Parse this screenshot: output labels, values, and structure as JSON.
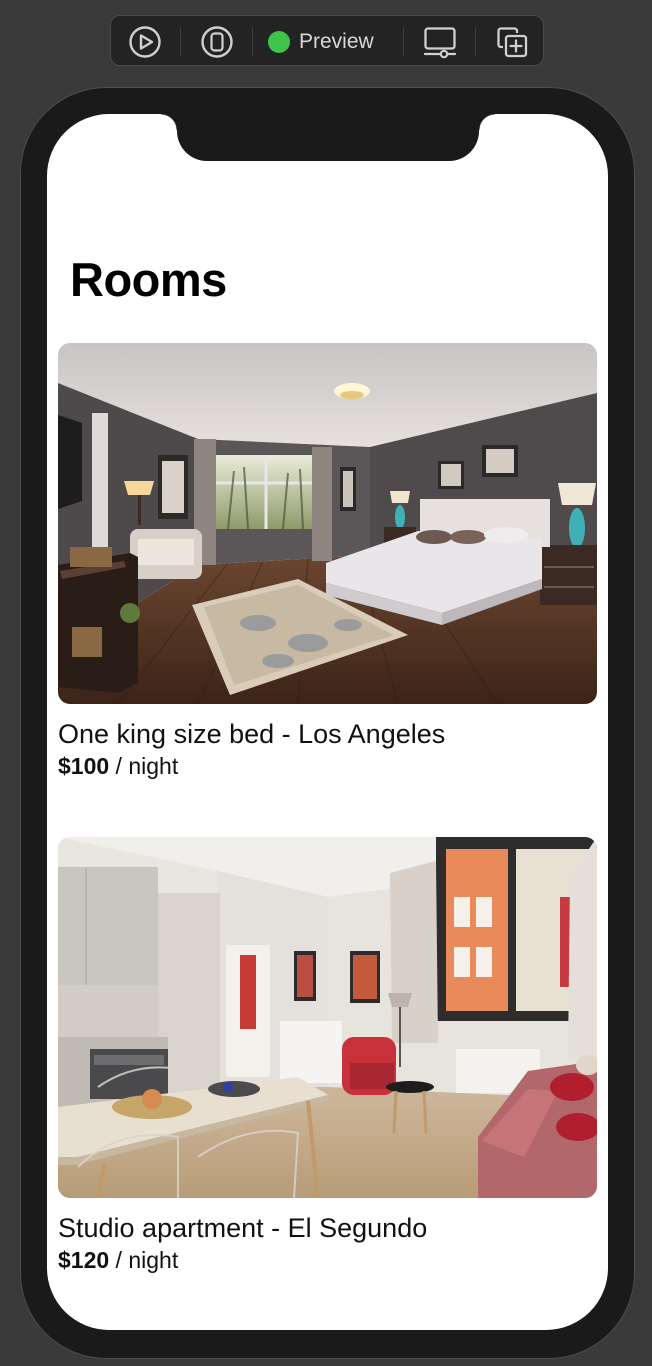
{
  "toolbar": {
    "preview_label": "Preview",
    "icons": [
      "play-circle-icon",
      "device-selector-icon",
      "preview-status-dot",
      "device-settings-icon",
      "duplicate-preview-icon"
    ],
    "status_color": "#3fc34a"
  },
  "page": {
    "title": "Rooms"
  },
  "rooms": [
    {
      "title": "One king size bed - Los Angeles",
      "price": "$100",
      "unit": " / night",
      "image": "bedroom-photo"
    },
    {
      "title": "Studio apartment - El Segundo",
      "price": "$120",
      "unit": " / night",
      "image": "studio-apartment-photo"
    }
  ]
}
